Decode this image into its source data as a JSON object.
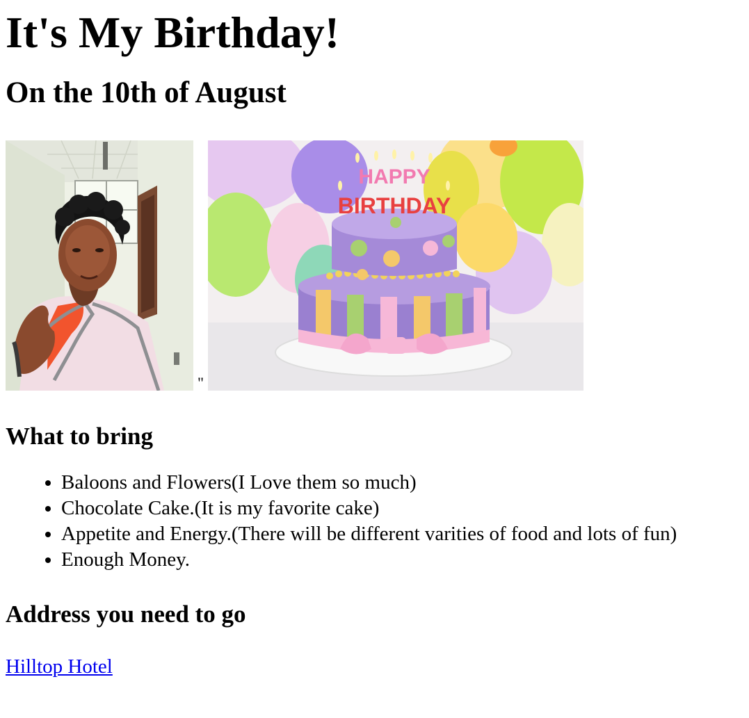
{
  "page": {
    "title": "It's My Birthday!",
    "subtitle": "On the 10th of August",
    "stray_quote": "\""
  },
  "bring": {
    "heading": "What to bring",
    "items": [
      "Baloons and Flowers(I Love them so much)",
      "Chocolate Cake.(It is my favorite cake)",
      "Appetite and Energy.(There will be different varities of food and lots of fun)",
      "Enough Money."
    ]
  },
  "address": {
    "heading": "Address you need to go",
    "link_text": "Hilltop Hotel"
  },
  "images": {
    "cake_topper": "HAPPY BIRTHDAY"
  },
  "colors": {
    "link": "#0000ee",
    "text": "#000000",
    "background": "#ffffff"
  }
}
